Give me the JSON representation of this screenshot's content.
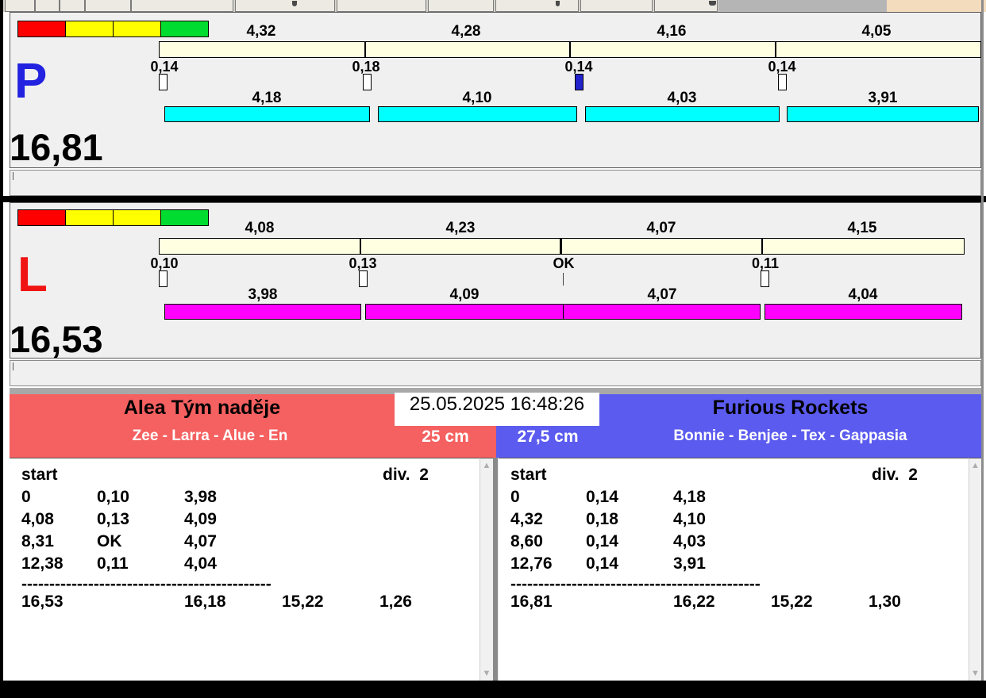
{
  "datetime": "25.05.2025 16:48:26",
  "colors": {
    "lane_right_letter": "#2222E0",
    "lane_left_letter": "#F01414",
    "dog_bar_right": "#00FFFF",
    "dog_bar_left": "#FF00FF",
    "split_bar": "#FFFFE1",
    "change_box_filled": "#2222CC",
    "team_left_bg": "#F56060",
    "team_right_bg": "#5B5BEF",
    "light_red": "#FF0000",
    "light_yellow": "#FFFF00",
    "light_green": "#00DC30"
  },
  "lanes": [
    {
      "letter": "P",
      "total": "16,81",
      "splits": [
        "4,32",
        "4,28",
        "4,16",
        "4,05"
      ],
      "changes": [
        "0,14",
        "0,18",
        "0,14",
        "0,14"
      ],
      "dogs": [
        "4,18",
        "4,10",
        "4,03",
        "3,91"
      ]
    },
    {
      "letter": "L",
      "total": "16,53",
      "splits": [
        "4,08",
        "4,23",
        "4,07",
        "4,15"
      ],
      "changes": [
        "0,10",
        "0,13",
        "OK",
        "0,11"
      ],
      "dogs": [
        "3,98",
        "4,09",
        "4,07",
        "4,04"
      ]
    }
  ],
  "teams": [
    {
      "name": "Alea Tým naděje",
      "members": "Zee - Larra - Alue - En",
      "height": "25 cm",
      "table": {
        "header_left": "start",
        "header_right": "div.  2",
        "rows": [
          [
            "0",
            "0,10",
            "3,98"
          ],
          [
            "4,08",
            "0,13",
            "4,09"
          ],
          [
            "8,31",
            "OK",
            "4,07"
          ],
          [
            "12,38",
            "0,11",
            "4,04"
          ]
        ],
        "dashes": "---------------------------------------------",
        "totals": [
          "16,53",
          "16,18",
          "15,22",
          "1,26"
        ]
      }
    },
    {
      "name": "Furious Rockets",
      "members": "Bonnie - Benjee - Tex - Gappasia",
      "height": "27,5 cm",
      "table": {
        "header_left": "start",
        "header_right": "div.  2",
        "rows": [
          [
            "0",
            "0,14",
            "4,18"
          ],
          [
            "4,32",
            "0,18",
            "4,10"
          ],
          [
            "8,60",
            "0,14",
            "4,03"
          ],
          [
            "12,76",
            "0,14",
            "3,91"
          ]
        ],
        "dashes": "---------------------------------------------",
        "totals": [
          "16,81",
          "16,22",
          "15,22",
          "1,30"
        ]
      }
    }
  ]
}
